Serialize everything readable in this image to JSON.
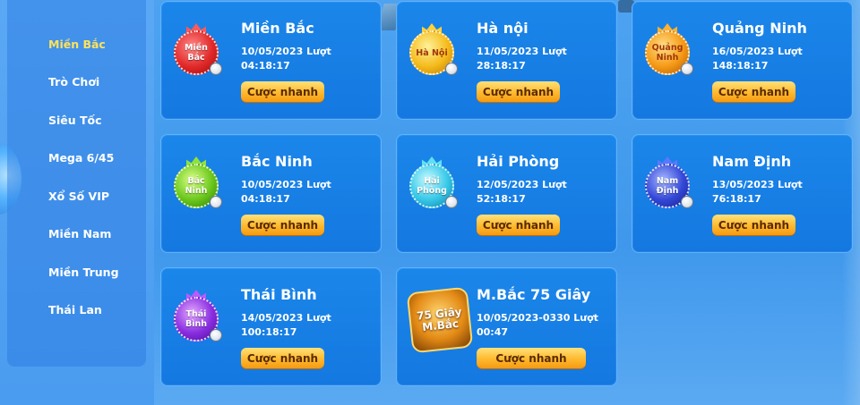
{
  "sidebar": {
    "items": [
      {
        "label": "Miền Bắc"
      },
      {
        "label": "Trò Chơi"
      },
      {
        "label": "Siêu Tốc"
      },
      {
        "label": "Mega 6/45"
      },
      {
        "label": "Xổ Số VIP"
      },
      {
        "label": "Miền Nam"
      },
      {
        "label": "Miền Trung"
      },
      {
        "label": "Thái Lan"
      }
    ],
    "active_index": 0,
    "active_color": "#ffe25a"
  },
  "cards": [
    {
      "title": "Miền Bắc",
      "date_line": "10/05/2023 Lượt",
      "time_line": "04:18:17",
      "button": "Cược nhanh",
      "logo_text": "Miền Bắc",
      "logo_color": "red"
    },
    {
      "title": "Hà nội",
      "date_line": "11/05/2023 Lượt",
      "time_line": "28:18:17",
      "button": "Cược nhanh",
      "logo_text": "Hà Nội",
      "logo_color": "gold"
    },
    {
      "title": "Quảng Ninh",
      "date_line": "16/05/2023 Lượt",
      "time_line": "148:18:17",
      "button": "Cược nhanh",
      "logo_text": "Quảng Ninh",
      "logo_color": "orange"
    },
    {
      "title": "Bắc Ninh",
      "date_line": "10/05/2023 Lượt",
      "time_line": "04:18:17",
      "button": "Cược nhanh",
      "logo_text": "Bắc Ninh",
      "logo_color": "green"
    },
    {
      "title": "Hải Phòng",
      "date_line": "12/05/2023 Lượt",
      "time_line": "52:18:17",
      "button": "Cược nhanh",
      "logo_text": "Hải Phòng",
      "logo_color": "cyan"
    },
    {
      "title": "Nam Định",
      "date_line": "13/05/2023 Lượt",
      "time_line": "76:18:17",
      "button": "Cược nhanh",
      "logo_text": "Nam Định",
      "logo_color": "blue"
    },
    {
      "title": "Thái Bình",
      "date_line": "14/05/2023 Lượt",
      "time_line": "100:18:17",
      "button": "Cược nhanh",
      "logo_text": "Thái Bình",
      "logo_color": "purple"
    },
    {
      "title": "M.Bắc 75 Giây",
      "date_line": "10/05/2023-0330 Lượt",
      "time_line": "00:47",
      "button": "Cược nhanh",
      "logo_text": "75 Giây M.Bắc",
      "logo_color": "gold75"
    }
  ],
  "icons": {
    "lottery_ball": "lottery-ball-icon",
    "crown": "crown-icon"
  },
  "colors": {
    "card_bg": "#1478e0",
    "button": "#ffb92e",
    "active_menu": "#ffe25a"
  }
}
